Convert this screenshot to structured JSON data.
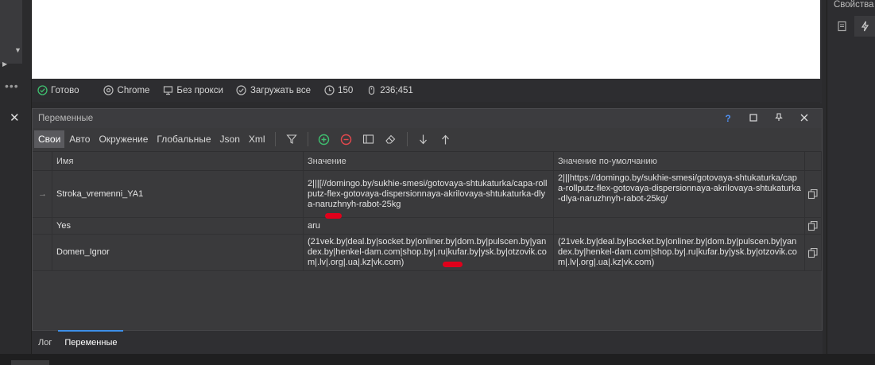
{
  "status_bar": {
    "ready": "Готово",
    "browser": "Chrome",
    "proxy": "Без прокси",
    "load_mode": "Загружать все",
    "timeout": "150",
    "mouse_pos": "236;451"
  },
  "right_panel": {
    "title": "Свойства з"
  },
  "variables_panel": {
    "title": "Переменные",
    "header_buttons": {
      "help": "?"
    },
    "tabs": [
      "Свои",
      "Авто",
      "Окружение",
      "Глобальные",
      "Json",
      "Xml"
    ],
    "columns": {
      "name": "Имя",
      "value": "Значение",
      "default": "Значение по-умолчанию"
    },
    "rows": [
      {
        "name": "Stroka_vremenni_YA1",
        "value": "2|||[//domingo.by/sukhie-smesi/gotovaya-shtukaturka/capa-rollputz-flex-gotovaya-dispersionnaya-akrilovaya-shtukaturka-dlya-naruzhnyh-rabot-25kg",
        "default": "2|||https://domingo.by/sukhie-smesi/gotovaya-shtukaturka/capa-rollputz-flex-gotovaya-dispersionnaya-akrilovaya-shtukaturka-dlya-naruzhnyh-rabot-25kg/"
      },
      {
        "name": "Yes",
        "value": "aru",
        "default": ""
      },
      {
        "name": "Domen_Ignor",
        "value": "(21vek.by|deal.by|socket.by|onliner.by|dom.by|pulscen.by|yandex.by|henkel-dam.com|shop.by|.ru|kufar.by|ysk.by|otzovik.com|.lv|.org|.ua|.kz|vk.com)",
        "default": "(21vek.by|deal.by|socket.by|onliner.by|dom.by|pulscen.by|yandex.by|henkel-dam.com|shop.by|.ru|kufar.by|ysk.by|otzovik.com|.lv|.org|.ua|.kz|vk.com)"
      }
    ]
  },
  "bottom_tabs": [
    "Лог",
    "Переменные"
  ],
  "colors": {
    "accent": "#3d8fe8",
    "panel_bg": "#3a3a3c",
    "red_mark": "#e0001b",
    "ok_green": "#3fbf6f"
  }
}
